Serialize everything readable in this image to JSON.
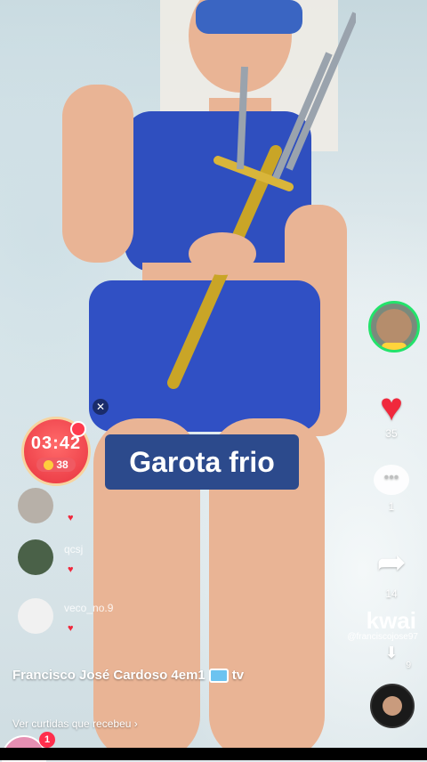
{
  "live": {
    "timer": "03:42",
    "coins": "38",
    "caption": "Garota frio"
  },
  "viewers": [
    {
      "name": ""
    },
    {
      "name": "qcsj"
    },
    {
      "name": "veco_no.9"
    }
  ],
  "side": {
    "likes": "35",
    "comments": "1",
    "shares": "14",
    "downloads": "9"
  },
  "brand": {
    "logo": "kwai",
    "handle": "@franciscojose97"
  },
  "author": {
    "name_part1": "Francisco José Cardoso 4em1",
    "name_part2": "tv"
  },
  "footer": {
    "see_likes": "Ver curtidas que recebeu  ›",
    "notification_count": "1"
  },
  "colors": {
    "caption_bg": "#2c4a8c",
    "heart": "#f0283c",
    "host_ring": "#23e36b"
  }
}
